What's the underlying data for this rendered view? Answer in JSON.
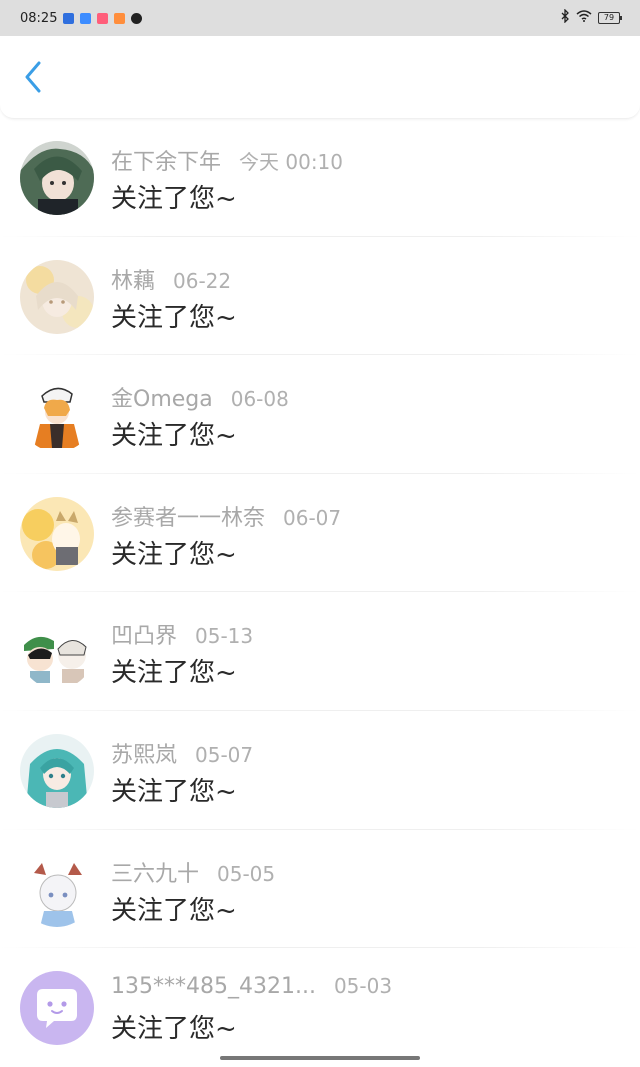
{
  "status_bar": {
    "time": "08:25",
    "battery": "79"
  },
  "header": {
    "back_icon": "chevron-left-icon",
    "accent": "#3a9ee6"
  },
  "notifications": [
    {
      "name": "在下余下年",
      "time": "今天 00:10",
      "message": "关注了您~",
      "avatar": "avatar-green-hair"
    },
    {
      "name": "林藕",
      "time": "06-22",
      "message": "关注了您~",
      "avatar": "avatar-blonde-soft"
    },
    {
      "name": "金Omega",
      "time": "06-08",
      "message": "关注了您~",
      "avatar": "avatar-orange-cap"
    },
    {
      "name": "参赛者一一林奈",
      "time": "06-07",
      "message": "关注了您~",
      "avatar": "avatar-yellow-cat"
    },
    {
      "name": "凹凸界",
      "time": "05-13",
      "message": "关注了您~",
      "avatar": "avatar-duo-chibi"
    },
    {
      "name": "苏熙岚",
      "time": "05-07",
      "message": "关注了您~",
      "avatar": "avatar-teal-hair"
    },
    {
      "name": "三六九十",
      "time": "05-05",
      "message": "关注了您~",
      "avatar": "avatar-white-hair"
    },
    {
      "name": "135***485_4321...",
      "time": "05-03",
      "message": "关注了您~",
      "avatar": "avatar-purple-chat"
    }
  ]
}
